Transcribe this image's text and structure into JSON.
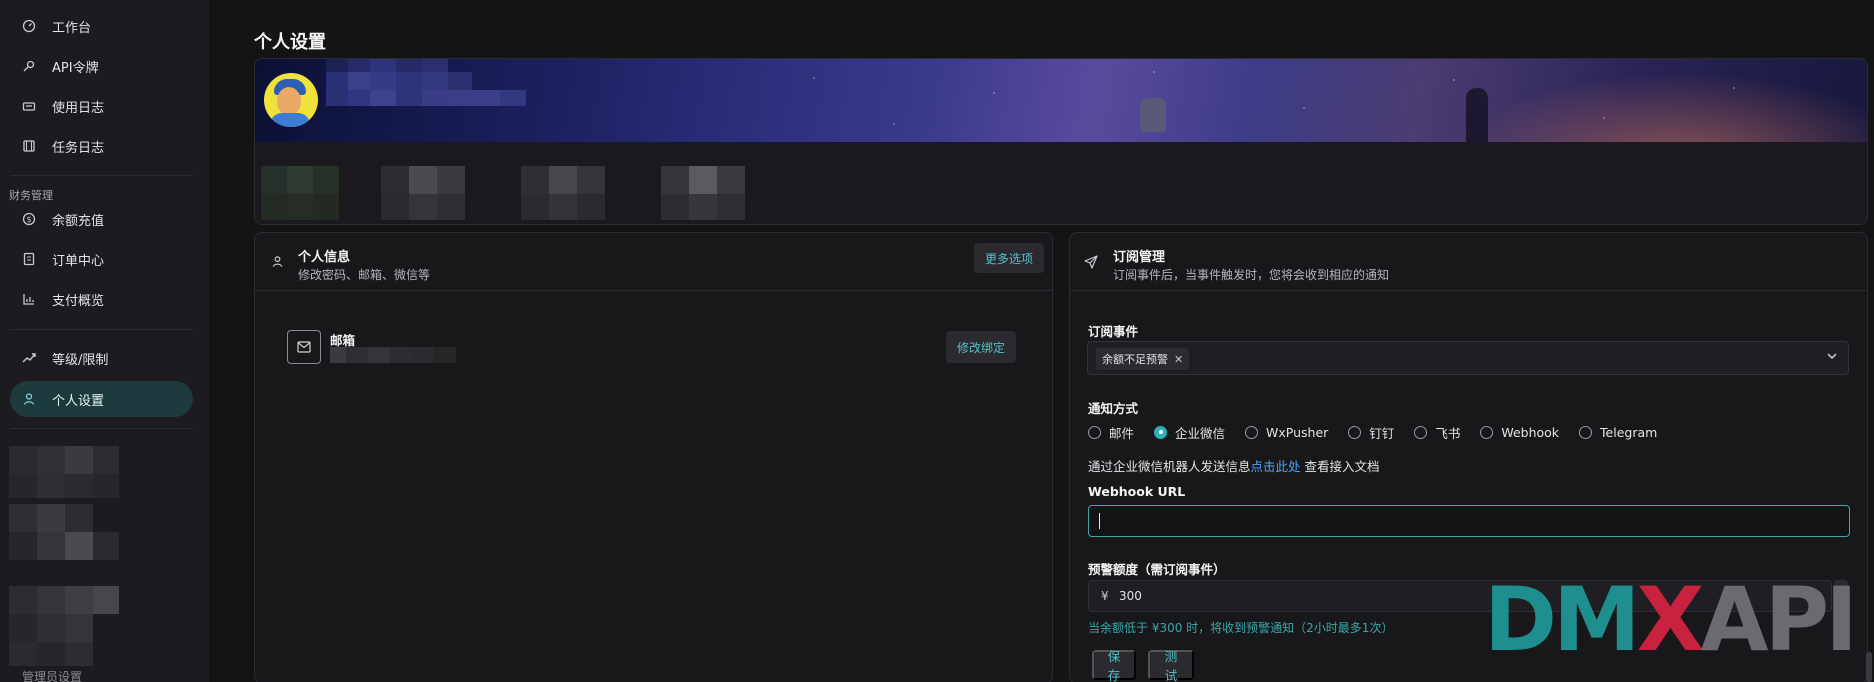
{
  "sidebar": {
    "items": [
      {
        "label": "工作台",
        "icon": "dashboard-icon"
      },
      {
        "label": "API令牌",
        "icon": "key-icon"
      },
      {
        "label": "使用日志",
        "icon": "log-icon"
      },
      {
        "label": "任务日志",
        "icon": "task-icon"
      }
    ],
    "finance_section": "财务管理",
    "finance_items": [
      {
        "label": "余额充值",
        "icon": "coin-icon"
      },
      {
        "label": "订单中心",
        "icon": "receipt-icon"
      },
      {
        "label": "支付概览",
        "icon": "chart-icon"
      }
    ],
    "other_items": [
      {
        "label": "等级/限制",
        "icon": "trend-icon"
      },
      {
        "label": "个人设置",
        "icon": "user-icon",
        "active": true
      }
    ],
    "bottom_label": "管理员设置"
  },
  "page": {
    "title": "个人设置"
  },
  "profile_card": {
    "title": "个人信息",
    "subtitle": "修改密码、邮箱、微信等",
    "more_button": "更多选项",
    "email_label": "邮箱",
    "rebind_button": "修改绑定"
  },
  "subscription_card": {
    "title": "订阅管理",
    "subtitle": "订阅事件后，当事件触发时，您将会收到相应的通知",
    "events_label": "订阅事件",
    "selected_event": "余额不足预警",
    "notify_label": "通知方式",
    "notify_options": [
      "邮件",
      "企业微信",
      "WxPusher",
      "钉钉",
      "飞书",
      "Webhook",
      "Telegram"
    ],
    "notify_selected": "企业微信",
    "hint_prefix": "通过企业微信机器人发送信息",
    "hint_link": "点击此处",
    "hint_suffix": " 查看接入文档",
    "webhook_label": "Webhook URL",
    "webhook_value": "",
    "threshold_label": "预警额度（需订阅事件）",
    "currency_symbol": "¥",
    "threshold_value": "300",
    "threshold_hint": "当余额低于 ¥300 时，将收到预警通知（2小时最多1次）",
    "save_button": "保存",
    "test_button": "测试"
  },
  "watermark": {
    "part1": "DM",
    "part2": "X",
    "part3": "API"
  },
  "colors": {
    "accent": "#2fb1b6",
    "background": "#141417",
    "sidebar": "#1c1c20",
    "active_nav": "#1d3a3d"
  }
}
